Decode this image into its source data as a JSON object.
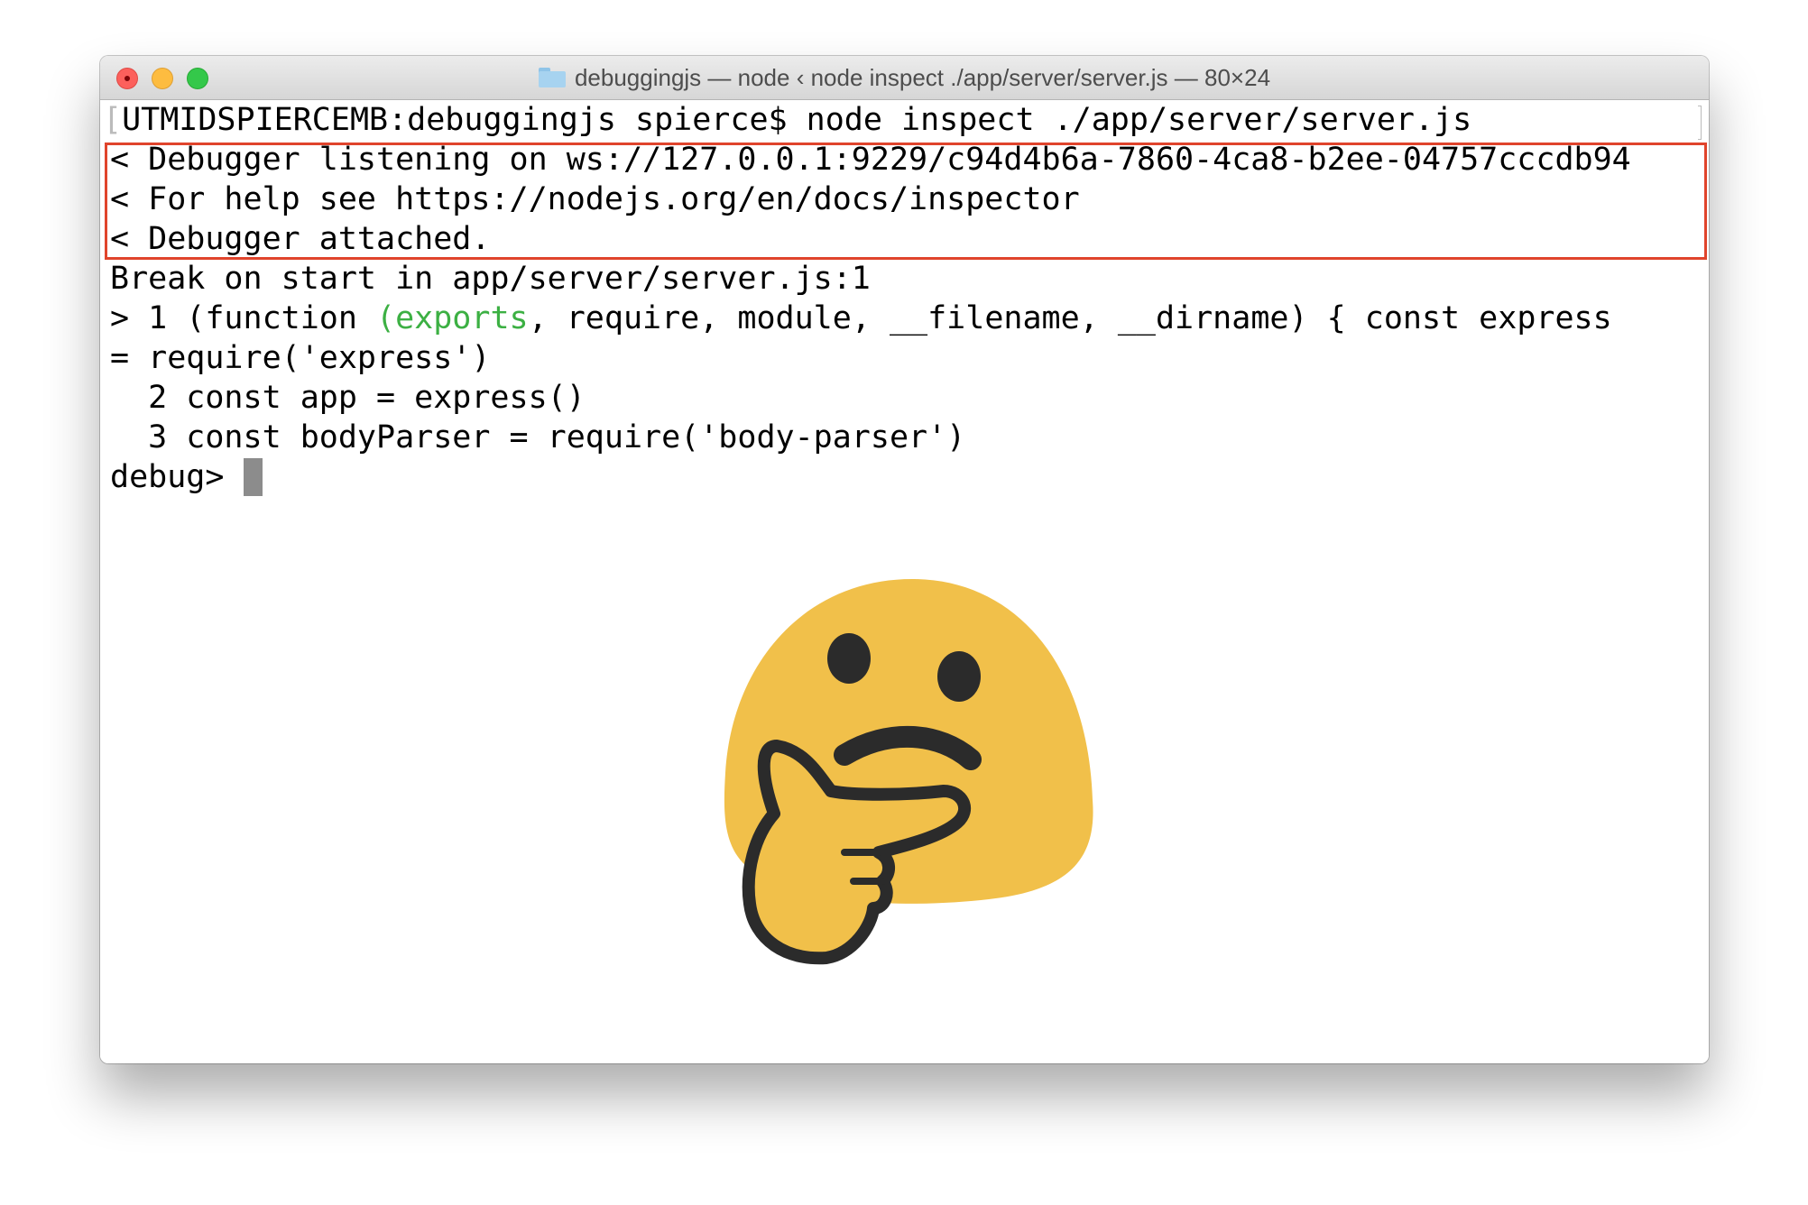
{
  "window": {
    "title": "debuggingjs — node ‹ node inspect ./app/server/server.js — 80×24"
  },
  "terminal": {
    "prompt_line": "UTMIDSPIERCEMB:debuggingjs spierce$ node inspect ./app/server/server.js",
    "highlighted_lines": [
      "< Debugger listening on ws://127.0.0.1:9229/c94d4b6a-7860-4ca8-b2ee-04757cccdb94",
      "< For help see https://nodejs.org/en/docs/inspector",
      "< Debugger attached."
    ],
    "break_line": "Break on start in app/server/server.js:1",
    "source_line_1": {
      "before": "> 1 (function ",
      "highlight": "(exports",
      "after": ", require, module, __filename, __dirname) { const express"
    },
    "source_line_1_wrap": "= require('express')",
    "source_line_2": "  2 const app = express()",
    "source_line_3": "  3 const bodyParser = require('body-parser')",
    "debug_prompt": "debug> "
  },
  "colors": {
    "highlight_border": "#e0442c",
    "syntax_green": "#3cb043",
    "emoji_face": "#f1c04a",
    "emoji_outline": "#2b2b2b"
  },
  "emoji": {
    "name": "thinking-face-icon"
  }
}
